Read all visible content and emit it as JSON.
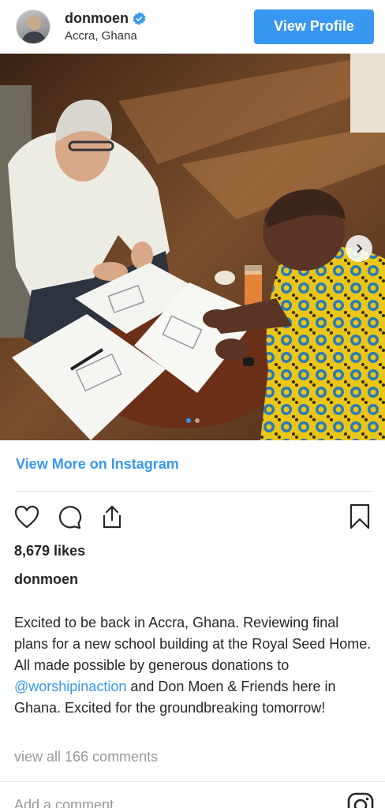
{
  "header": {
    "username": "donmoen",
    "location": "Accra, Ghana",
    "view_profile_label": "View Profile"
  },
  "icons": {
    "verified": "verified-badge-icon",
    "next": "chevron-right-icon",
    "like": "heart-icon",
    "comment": "comment-icon",
    "share": "share-icon",
    "save": "bookmark-icon",
    "instagram": "instagram-logo-icon"
  },
  "colors": {
    "accent": "#3897f0",
    "text": "#262626",
    "muted": "#999999"
  },
  "carousel": {
    "slide_count": 2,
    "active_index": 0
  },
  "post": {
    "view_more_label": "View More on Instagram",
    "likes": "8,679 likes",
    "caption_user": "donmoen",
    "caption_before": "Excited to be back in Accra, Ghana. Reviewing final plans for a new school building at the Royal Seed Home. All made possible by generous donations to ",
    "caption_mention": "@worshipinaction",
    "caption_after": " and Don Moen & Friends here in Ghana. Excited for the groundbreaking tomorrow!",
    "view_comments": "view all 166 comments",
    "add_comment_placeholder": "Add a comment..."
  }
}
